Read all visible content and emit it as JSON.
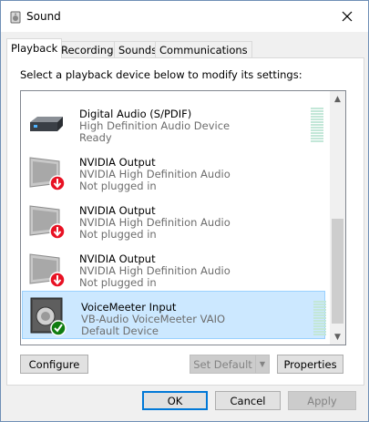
{
  "window": {
    "title": "Sound"
  },
  "tabs": [
    {
      "label": "Playback"
    },
    {
      "label": "Recording"
    },
    {
      "label": "Sounds"
    },
    {
      "label": "Communications"
    }
  ],
  "instruction": "Select a playback device below to modify its settings:",
  "devices": [
    {
      "name": "Digital Audio (S/PDIF)",
      "description": "High Definition Audio Device",
      "status": "Ready",
      "icon": "spdif-device-icon"
    },
    {
      "name": "NVIDIA Output",
      "description": "NVIDIA High Definition Audio",
      "status": "Not plugged in",
      "icon": "monitor-unplugged-icon"
    },
    {
      "name": "NVIDIA Output",
      "description": "NVIDIA High Definition Audio",
      "status": "Not plugged in",
      "icon": "monitor-unplugged-icon"
    },
    {
      "name": "NVIDIA Output",
      "description": "NVIDIA High Definition Audio",
      "status": "Not plugged in",
      "icon": "monitor-unplugged-icon"
    },
    {
      "name": "VoiceMeeter Input",
      "description": "VB-Audio VoiceMeeter VAIO",
      "status": "Default Device",
      "icon": "speaker-default-icon",
      "selected": true
    }
  ],
  "buttons": {
    "configure": "Configure",
    "set_default": "Set Default",
    "properties": "Properties",
    "ok": "OK",
    "cancel": "Cancel",
    "apply": "Apply"
  },
  "colors": {
    "selection_bg": "#cce8ff",
    "status_green": "#107c10",
    "status_red": "#e81123"
  }
}
